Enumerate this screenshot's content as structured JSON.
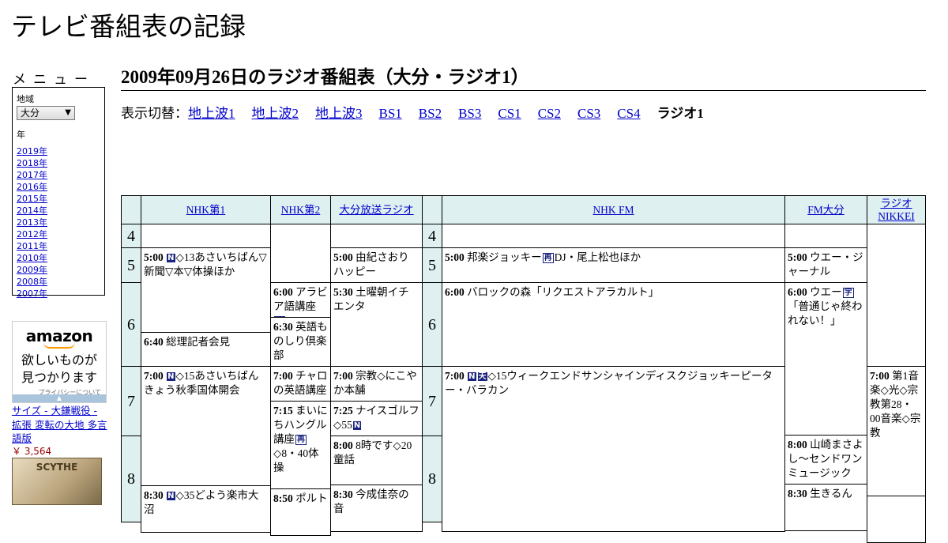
{
  "site": {
    "title": "テレビ番組表の記録"
  },
  "menu": {
    "title": "メニュー",
    "region_label": "地域",
    "region_value": "大分",
    "year_label": "年",
    "years": [
      "2019年",
      "2018年",
      "2017年",
      "2016年",
      "2015年",
      "2014年",
      "2013年",
      "2012年",
      "2011年",
      "2010年",
      "2009年",
      "2008年",
      "2007年"
    ]
  },
  "ad": {
    "logo": "amazon",
    "tagline_1": "欲しいものが",
    "tagline_2": "見つかります",
    "privacy": "プライバシーについて",
    "product_title": "サイズ - 大鎌戦役 - 拡張 変転の大地 多言語版",
    "product_price": "￥ 3,564",
    "product_image_text": "SCYTHE"
  },
  "page": {
    "heading": "2009年09月26日のラジオ番組表（大分・ラジオ1）"
  },
  "switcher": {
    "label": "表示切替：",
    "links": [
      "地上波1",
      "地上波2",
      "地上波3",
      "BS1",
      "BS2",
      "BS3",
      "CS1",
      "CS2",
      "CS3",
      "CS4"
    ],
    "current": "ラジオ1"
  },
  "schedule": {
    "channels": [
      "NHK第1",
      "NHK第2",
      "大分放送ラジオ",
      "NHK FM",
      "FM大分",
      "ラジオNIKKEI"
    ],
    "hours": [
      "4",
      "5",
      "6",
      "7",
      "8"
    ],
    "programs": [
      {
        "time": "5:00",
        "badges": [
          "N"
        ],
        "title": "◇13あさいちばん▽新聞▽本▽体操ほか"
      },
      {
        "time": "6:40",
        "badges": [],
        "title": "総理記者会見"
      },
      {
        "time": "7:00",
        "badges": [
          "N"
        ],
        "title": "◇15あさいちばんきょう秋季国体開会"
      },
      {
        "time": "8:30",
        "badges": [
          "N"
        ],
        "title": "◇35どよう楽市大沼"
      },
      {
        "time": "6:00",
        "badges": [],
        "title": "アラビア語講座",
        "badge_after": "再"
      },
      {
        "time": "6:30",
        "badges": [],
        "title": "英語ものしり倶楽部"
      },
      {
        "time": "7:00",
        "badges": [],
        "title": "チャロの英語講座"
      },
      {
        "time": "7:15",
        "badges": [],
        "title": "まいにちハングル講座",
        "badge_after": "再",
        "title_after": "◇8・40体操"
      },
      {
        "time": "8:50",
        "badges": [],
        "title": "ポルト"
      },
      {
        "time": "5:00",
        "badges": [],
        "title": "由紀さおりハッピー"
      },
      {
        "time": "5:30",
        "badges": [],
        "title": "土曜朝イチエンタ"
      },
      {
        "time": "7:00",
        "badges": [],
        "title": "宗教◇にこやか本舗"
      },
      {
        "time": "7:25",
        "badges": [],
        "title": "ナイスゴルフ◇55",
        "badge_after": "N"
      },
      {
        "time": "8:00",
        "badges": [],
        "title": "8時です◇20童話"
      },
      {
        "time": "8:30",
        "badges": [],
        "title": "今成佳奈の音"
      },
      {
        "time": "5:00",
        "badges": [],
        "title": "邦楽ジョッキー",
        "badge_after": "再",
        "title_after": "DJ・尾上松也ほか"
      },
      {
        "time": "6:00",
        "badges": [],
        "title": "バロックの森「リクエストアラカルト」"
      },
      {
        "time": "7:00",
        "badges": [
          "N",
          "天"
        ],
        "title": "◇15ウィークエンドサンシャインディスクジョッキーピーター・バラカン"
      },
      {
        "time": "5:00",
        "badges": [],
        "title": "ウエー・ジャーナル"
      },
      {
        "time": "6:00",
        "badges": [],
        "title": "ウエー",
        "badge_after": "字",
        "title_after": "「普通じゃ終われない！」"
      },
      {
        "time": "8:00",
        "badges": [],
        "title": "山崎まさよし～センドワンミュージック"
      },
      {
        "time": "8:30",
        "badges": [],
        "title": "生きるん"
      },
      {
        "time": "7:00",
        "badges": [],
        "title": "第1音楽◇光◇宗教第28・00音楽◇宗教"
      }
    ]
  }
}
